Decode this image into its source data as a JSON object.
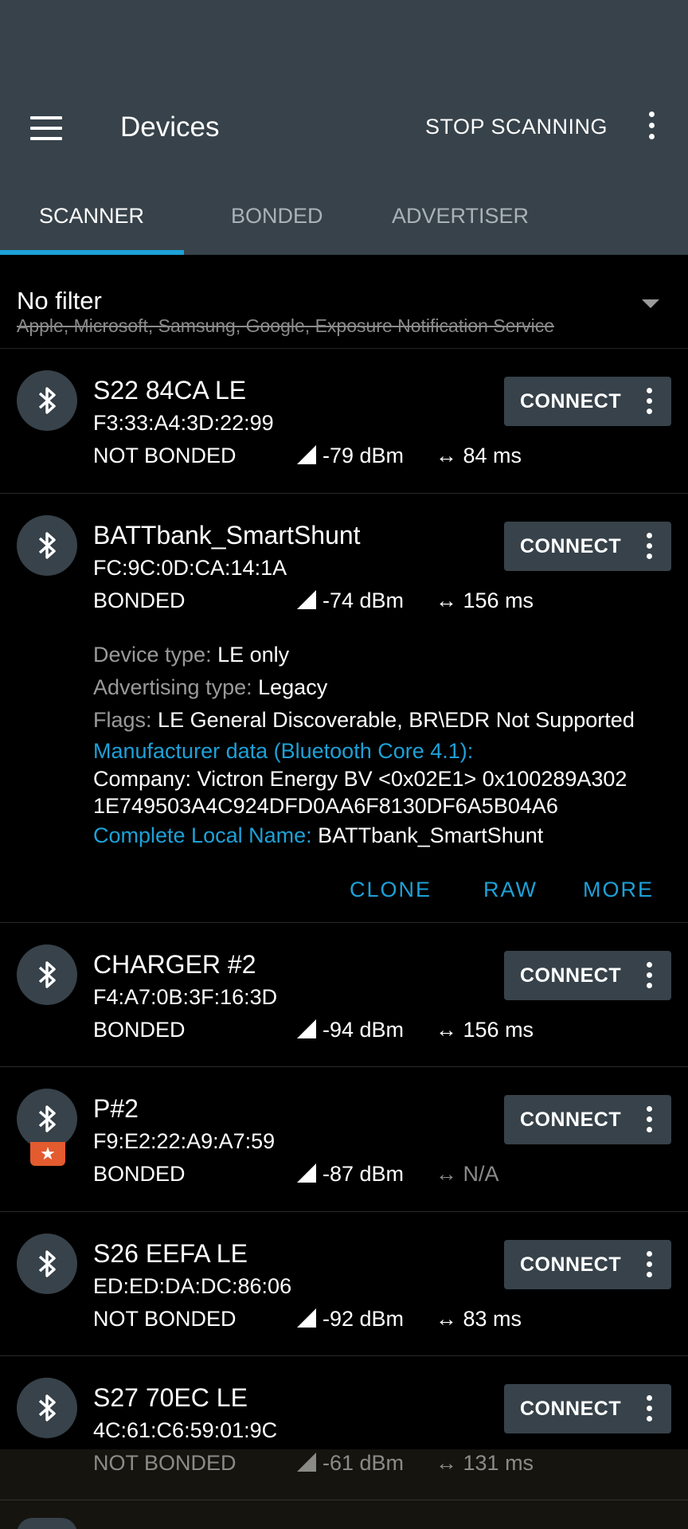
{
  "appbar": {
    "title": "Devices",
    "stop_label": "STOP SCANNING",
    "tabs": [
      "SCANNER",
      "BONDED",
      "ADVERTISER"
    ]
  },
  "filter": {
    "title": "No filter",
    "subtitle": "Apple, Microsoft, Samsung, Google, Exposure Notification Service"
  },
  "connect_label": "CONNECT",
  "devices": [
    {
      "name": "S22 84CA LE",
      "mac": "F3:33:A4:3D:22:99",
      "bond": "NOT BONDED",
      "rssi": "-79 dBm",
      "interval": "84 ms"
    },
    {
      "name": "BATTbank_SmartShunt",
      "mac": "FC:9C:0D:CA:14:1A",
      "bond": "BONDED",
      "rssi": "-74 dBm",
      "interval": "156 ms"
    },
    {
      "name": "CHARGER #2",
      "mac": "F4:A7:0B:3F:16:3D",
      "bond": "BONDED",
      "rssi": "-94 dBm",
      "interval": "156 ms"
    },
    {
      "name": "P#2",
      "mac": "F9:E2:22:A9:A7:59",
      "bond": "BONDED",
      "rssi": "-87 dBm",
      "interval": "N/A"
    },
    {
      "name": "S26 EEFA LE",
      "mac": "ED:ED:DA:DC:86:06",
      "bond": "NOT BONDED",
      "rssi": "-92 dBm",
      "interval": "83 ms"
    },
    {
      "name": "S27 70EC LE",
      "mac": "4C:61:C6:59:01:9C",
      "bond": "NOT BONDED",
      "rssi": "-61 dBm",
      "interval": "131 ms"
    }
  ],
  "details": {
    "device_type_label": "Device type:",
    "device_type": "LE only",
    "adv_type_label": "Advertising type:",
    "adv_type": "Legacy",
    "flags_label": "Flags:",
    "flags": "LE General Discoverable, BR\\EDR Not Supported",
    "mfr_label": "Manufacturer data (Bluetooth Core 4.1):",
    "mfr_line1": "Company: Victron Energy BV <0x02E1> 0x100289A302",
    "mfr_line2": "1E749503A4C924DFD0AA6F8130DF6A5B04A6",
    "local_name_label": "Complete Local Name:",
    "local_name": "BATTbank_SmartShunt",
    "actions": [
      "CLONE",
      "RAW",
      "MORE"
    ]
  }
}
